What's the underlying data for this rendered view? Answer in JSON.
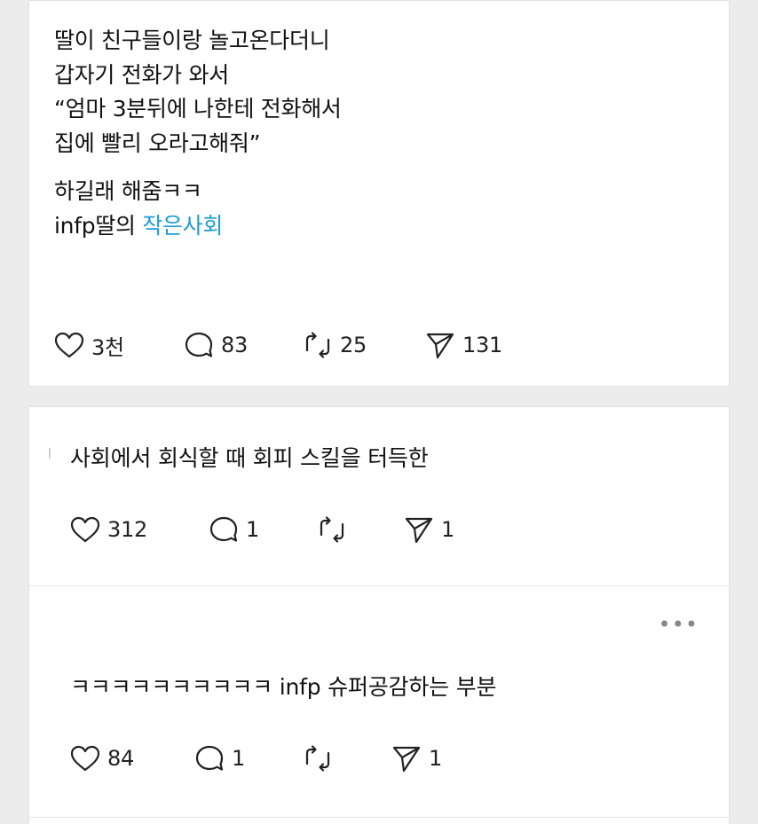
{
  "post": {
    "lines": [
      "딸이 친구들이랑 놀고온다더니",
      "갑자기 전화가 와서",
      "“엄마 3분뒤에 나한테 전화해서",
      "집에 빨리 오라고해줘”"
    ],
    "line5": "하길래 해줌ㅋㅋ",
    "line6_prefix": "infp딸의 ",
    "line6_link": "작은사회",
    "likes": "3천",
    "comments": "83",
    "reposts": "25",
    "shares": "131"
  },
  "comments": [
    {
      "text": "사회에서 회식할 때 회피 스킬을 터득한",
      "likes": "312",
      "comments": "1",
      "reposts": "",
      "shares": "1"
    },
    {
      "more": "•••",
      "text": "ㅋㅋㅋㅋㅋㅋㅋㅋㅋㅋ infp 슈퍼공감하는 부분",
      "likes": "84",
      "comments": "1",
      "reposts": "",
      "shares": "1"
    }
  ],
  "colors": {
    "link": "#1d9bd6",
    "icon": "#222222"
  },
  "icons": [
    "heart-icon",
    "comment-icon",
    "repost-icon",
    "send-icon",
    "more-icon"
  ]
}
